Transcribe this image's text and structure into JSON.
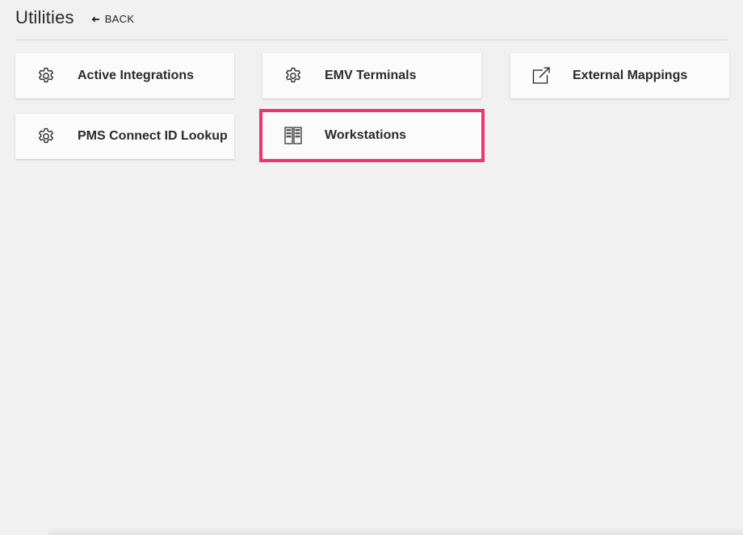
{
  "header": {
    "title": "Utilities",
    "back_label": "BACK"
  },
  "tiles": [
    {
      "label": "Active Integrations",
      "icon": "gear-icon"
    },
    {
      "label": "EMV Terminals",
      "icon": "gear-icon"
    },
    {
      "label": "External Mappings",
      "icon": "external-link-icon"
    },
    {
      "label": "PMS Connect ID Lookup",
      "icon": "gear-icon"
    },
    {
      "label": "Workstations",
      "icon": "workstations-icon",
      "highlighted": true
    }
  ],
  "colors": {
    "highlight": "#f2346e",
    "background": "#f1f1f1",
    "tile_background": "#fbfbfb"
  }
}
